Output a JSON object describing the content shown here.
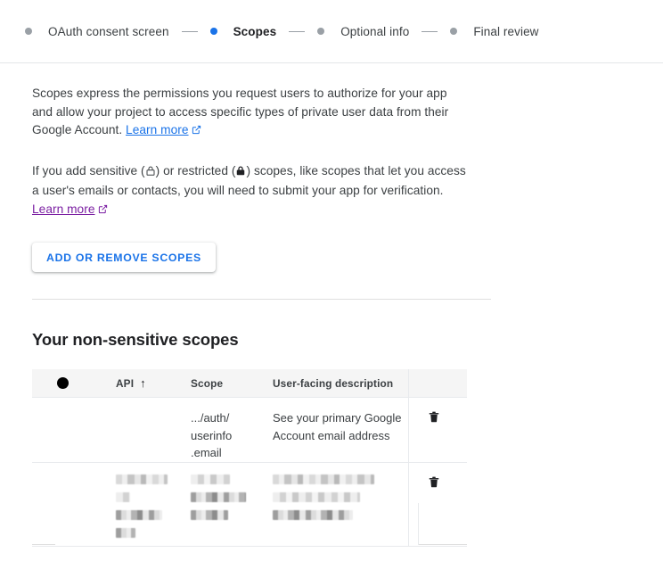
{
  "stepper": {
    "steps": [
      {
        "label": "OAuth consent screen",
        "active": false
      },
      {
        "label": "Scopes",
        "active": true
      },
      {
        "label": "Optional info",
        "active": false
      },
      {
        "label": "Final review",
        "active": false
      }
    ]
  },
  "intro": {
    "paragraph1_before_link": "Scopes express the permissions you request users to authorize for your app and allow your project to access specific types of private user data from their Google Account. ",
    "paragraph1_link": "Learn more",
    "paragraph2_part1": "If you add sensitive (",
    "paragraph2_part2": ") or restricted (",
    "paragraph2_part3": ") scopes, like scopes that let you access a user's emails or contacts, you will need to submit your app for verification. ",
    "paragraph2_link": "Learn more",
    "sensitive_icon": "lock-outline-icon",
    "restricted_icon": "lock-filled-icon",
    "external_link_icon": "external-link-icon",
    "link_color": "#1a73e8",
    "visited_link_color": "#7b1fa2"
  },
  "actions": {
    "add_or_remove_scopes_label": "ADD OR REMOVE SCOPES"
  },
  "scopes_section": {
    "title": "Your non-sensitive scopes",
    "table": {
      "columns": [
        {
          "key": "check",
          "label": "",
          "icon": "redacted-checkbox-icon"
        },
        {
          "key": "api",
          "label": "API",
          "sort": "ascending",
          "sort_icon": "arrow-up-icon"
        },
        {
          "key": "scope",
          "label": "Scope"
        },
        {
          "key": "description",
          "label": "User-facing description"
        },
        {
          "key": "action",
          "label": ""
        }
      ],
      "rows": [
        {
          "api": "",
          "api_redacted": false,
          "scope": ".../auth/\nuserinfo\n.email",
          "scope_lines": [
            ".../auth/",
            "userinfo",
            ".email"
          ],
          "description": "See your primary Google Account email address",
          "redacted": false,
          "delete_icon": "trash-icon"
        },
        {
          "api": "",
          "scope": "",
          "description": "",
          "redacted": true,
          "delete_icon": "trash-icon"
        }
      ]
    }
  },
  "colors": {
    "accent_blue": "#1a73e8",
    "visited_purple": "#7b1fa2",
    "text_primary": "#202124",
    "text_secondary": "#3c4043",
    "dot_inactive": "#9aa0a6",
    "divider": "#e0e0e0",
    "table_header_bg": "#f5f5f5"
  }
}
